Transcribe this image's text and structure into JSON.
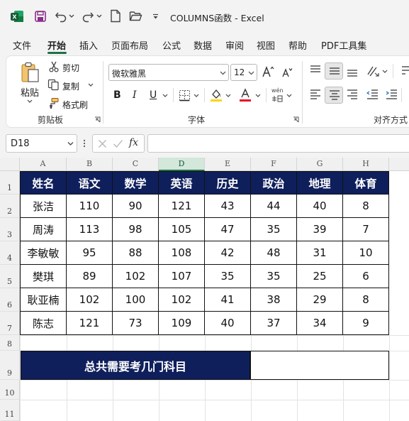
{
  "app": {
    "title": "COLUMNS函数  -  Excel"
  },
  "tabs": [
    "文件",
    "开始",
    "插入",
    "页面布局",
    "公式",
    "数据",
    "审阅",
    "视图",
    "帮助",
    "PDF工具集"
  ],
  "active_tab": "开始",
  "ribbon": {
    "clipboard": {
      "paste": "粘贴",
      "cut": "剪切",
      "copy": "复制",
      "format_painter": "格式刷",
      "group": "剪贴板"
    },
    "font": {
      "font_name": "微软雅黑",
      "font_size": "12",
      "bold": "B",
      "italic": "I",
      "underline": "U",
      "phonetic": "wén",
      "group": "字体"
    },
    "alignment": {
      "group": "对齐方式"
    }
  },
  "formula_bar": {
    "name_box": "D18",
    "fx": "fx",
    "formula": ""
  },
  "columns": [
    "A",
    "B",
    "C",
    "D",
    "E",
    "F",
    "G",
    "H"
  ],
  "selected_column": "D",
  "rows": [
    "1",
    "2",
    "3",
    "4",
    "5",
    "6",
    "7",
    "8",
    "9",
    "10",
    "11"
  ],
  "table": {
    "headers": [
      "姓名",
      "语文",
      "数学",
      "英语",
      "历史",
      "政治",
      "地理",
      "体育"
    ],
    "rows": [
      [
        "张洁",
        "110",
        "90",
        "121",
        "43",
        "44",
        "40",
        "8"
      ],
      [
        "周涛",
        "113",
        "98",
        "105",
        "47",
        "35",
        "39",
        "7"
      ],
      [
        "李敏敏",
        "95",
        "88",
        "108",
        "42",
        "48",
        "31",
        "10"
      ],
      [
        "樊琪",
        "89",
        "102",
        "107",
        "35",
        "35",
        "25",
        "6"
      ],
      [
        "耿亚楠",
        "102",
        "100",
        "102",
        "41",
        "38",
        "29",
        "8"
      ],
      [
        "陈志",
        "121",
        "73",
        "109",
        "40",
        "37",
        "34",
        "9"
      ]
    ]
  },
  "summary": {
    "label": "总共需要考几门科目",
    "value": ""
  },
  "colors": {
    "header_fill": "#0f1f5c",
    "accent": "#1e7145"
  }
}
